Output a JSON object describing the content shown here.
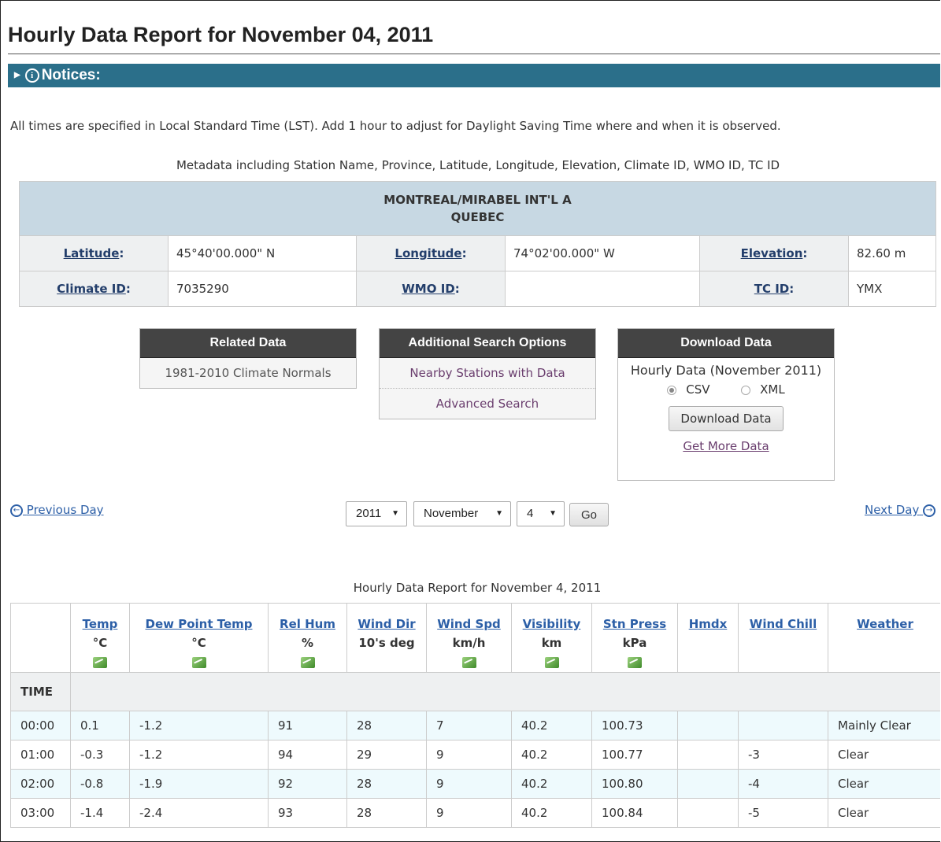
{
  "title": "Hourly Data Report for November 04, 2011",
  "notices_label": "Notices:",
  "lst_note": "All times are specified in Local Standard Time (LST). Add 1 hour to adjust for Daylight Saving Time where and when it is observed.",
  "metadata_caption": "Metadata including Station Name, Province, Latitude, Longitude, Elevation, Climate ID, WMO ID, TC ID",
  "station": {
    "name": "MONTREAL/MIRABEL INT'L A",
    "province": "QUEBEC",
    "latitude_label": "Latitude",
    "latitude": "45°40'00.000\" N",
    "longitude_label": "Longitude",
    "longitude": "74°02'00.000\" W",
    "elevation_label": "Elevation",
    "elevation": "82.60 m",
    "climate_id_label": "Climate ID",
    "climate_id": "7035290",
    "wmo_id_label": "WMO ID",
    "wmo_id": "",
    "tc_id_label": "TC ID",
    "tc_id": "YMX"
  },
  "related": {
    "header": "Related Data",
    "items": [
      "1981-2010 Climate Normals"
    ]
  },
  "additional": {
    "header": "Additional Search Options",
    "items": [
      "Nearby Stations with Data",
      "Advanced Search"
    ]
  },
  "download": {
    "header": "Download Data",
    "title": "Hourly Data (November 2011)",
    "format_csv": "CSV",
    "format_xml": "XML",
    "selected_format": "CSV",
    "button": "Download Data",
    "more": "Get More Data"
  },
  "nav": {
    "prev": "Previous Day",
    "next": "Next Day",
    "year": "2011",
    "month": "November",
    "day": "4",
    "go": "Go"
  },
  "table": {
    "caption": "Hourly Data Report for November 4, 2011",
    "columns": [
      {
        "label": "Temp",
        "unit": "°C",
        "chart": true
      },
      {
        "label": "Dew Point Temp",
        "unit": "°C",
        "chart": true
      },
      {
        "label": "Rel Hum",
        "unit": "%",
        "chart": true
      },
      {
        "label": "Wind Dir",
        "unit": "10's deg",
        "chart": false
      },
      {
        "label": "Wind Spd",
        "unit": "km/h",
        "chart": true
      },
      {
        "label": "Visibility",
        "unit": "km",
        "chart": true
      },
      {
        "label": "Stn Press",
        "unit": "kPa",
        "chart": true
      },
      {
        "label": "Hmdx",
        "unit": "",
        "chart": false
      },
      {
        "label": "Wind Chill",
        "unit": "",
        "chart": false
      },
      {
        "label": "Weather",
        "unit": "",
        "chart": false
      }
    ],
    "time_label": "TIME",
    "rows": [
      [
        "00:00",
        "0.1",
        "-1.2",
        "91",
        "28",
        "7",
        "40.2",
        "100.73",
        "",
        "",
        "Mainly Clear"
      ],
      [
        "01:00",
        "-0.3",
        "-1.2",
        "94",
        "29",
        "9",
        "40.2",
        "100.77",
        "",
        "-3",
        "Clear"
      ],
      [
        "02:00",
        "-0.8",
        "-1.9",
        "92",
        "28",
        "9",
        "40.2",
        "100.80",
        "",
        "-4",
        "Clear"
      ],
      [
        "03:00",
        "-1.4",
        "-2.4",
        "93",
        "28",
        "9",
        "40.2",
        "100.84",
        "",
        "-5",
        "Clear"
      ]
    ]
  }
}
